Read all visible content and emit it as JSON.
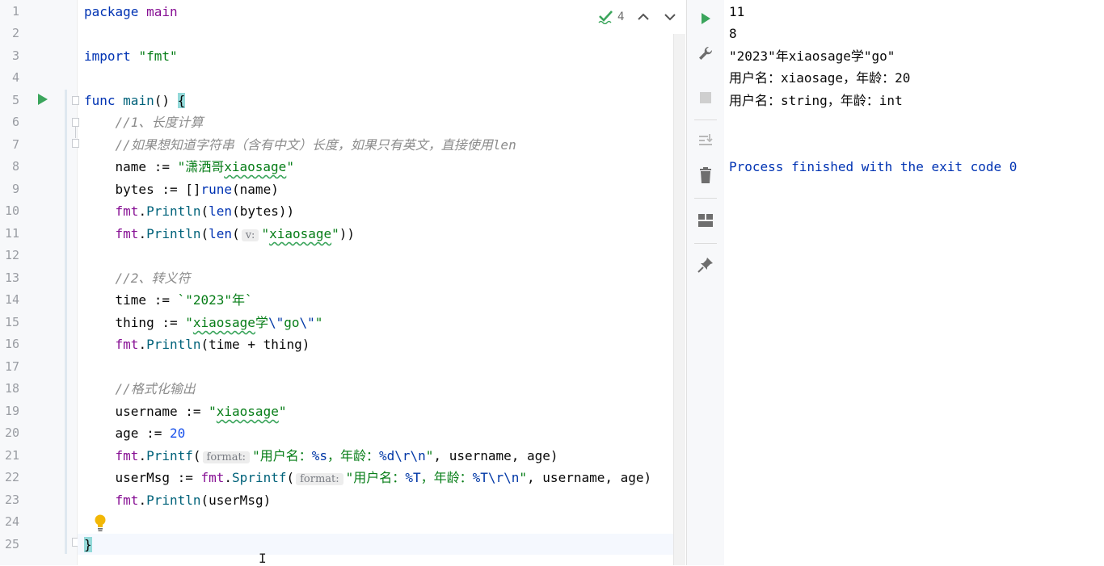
{
  "editor": {
    "line_numbers": [
      "1",
      "2",
      "3",
      "4",
      "5",
      "6",
      "7",
      "8",
      "9",
      "10",
      "11",
      "12",
      "13",
      "14",
      "15",
      "16",
      "17",
      "18",
      "19",
      "20",
      "21",
      "22",
      "23",
      "24",
      "25"
    ],
    "code": {
      "l1_kw": "package",
      "l1_name": "main",
      "l3_kw": "import",
      "l3_str": "\"fmt\"",
      "l5_kw": "func",
      "l5_fn": "main",
      "l5_rest": "() ",
      "l5_brace": "{",
      "l6": "//1、长度计算",
      "l7": "//如果想知道字符串（含有中文）长度，如果只有英文，直接使用len",
      "l8_a": "name := ",
      "l8_q1": "\"",
      "l8_s1": "潇洒哥",
      "l8_s2": "xiaosage",
      "l8_q2": "\"",
      "l9_a": "bytes := []",
      "l9_kw": "rune",
      "l9_b": "(name)",
      "l10_pkg": "fmt",
      "l10_dot": ".",
      "l10_fn": "Println",
      "l10_p": "(",
      "l10_len": "len",
      "l10_rest": "(bytes))",
      "l11_pkg": "fmt",
      "l11_dot": ".",
      "l11_fn": "Println",
      "l11_p": "(",
      "l11_len": "len",
      "l11_p2": "(",
      "l11_hint": "v:",
      "l11_q1": "\"",
      "l11_s": "xiaosage",
      "l11_q2": "\"",
      "l11_rest": "))",
      "l13": "//2、转义符",
      "l14_a": "time := ",
      "l14_s": "`\"2023\"年`",
      "l15_a": "thing := ",
      "l15_q1": "\"",
      "l15_s1": "xiaosage",
      "l15_s2": "学",
      "l15_e1": "\\\"",
      "l15_s3": "go",
      "l15_e2": "\\\"",
      "l15_q2": "\"",
      "l16_pkg": "fmt",
      "l16_dot": ".",
      "l16_fn": "Println",
      "l16_rest": "(time + thing)",
      "l18": "//格式化输出",
      "l19_a": "username := ",
      "l19_q1": "\"",
      "l19_s": "xiaosage",
      "l19_q2": "\"",
      "l20_a": "age := ",
      "l20_n": "20",
      "l21_pkg": "fmt",
      "l21_dot": ".",
      "l21_fn": "Printf",
      "l21_p": "(",
      "l21_hint": "format:",
      "l21_s1": "\"用户名：",
      "l21_v1": "%s",
      "l21_s2": "，年龄：",
      "l21_v2": "%d",
      "l21_e": "\\r\\n",
      "l21_s3": "\"",
      "l21_rest": ", username, age)",
      "l22_a": "userMsg := ",
      "l22_pkg": "fmt",
      "l22_dot": ".",
      "l22_fn": "Sprintf",
      "l22_p": "(",
      "l22_hint": "format:",
      "l22_s1": "\"用户名：",
      "l22_v1": "%T",
      "l22_s2": "，年龄：",
      "l22_v2": "%T",
      "l22_e": "\\r\\n",
      "l22_s3": "\"",
      "l22_rest": ", username, age)",
      "l23_pkg": "fmt",
      "l23_dot": ".",
      "l23_fn": "Println",
      "l23_rest": "(userMsg)",
      "l25": "}"
    },
    "inspection_count": "4"
  },
  "console": {
    "lines": [
      "11",
      "8",
      "\"2023\"年xiaosage学\"go\"",
      "用户名：xiaosage，年龄：20",
      "用户名：string，年龄：int"
    ],
    "finish": "Process finished with the exit code 0"
  },
  "toolbar": {
    "icons": [
      "rerun-icon",
      "wrench-icon",
      "stop-icon",
      "scroll-to-end-icon",
      "trash-icon",
      "layout-icon",
      "pin-icon"
    ]
  },
  "colors": {
    "keyword": "#0033b3",
    "function": "#00627a",
    "string": "#067d17",
    "number": "#1750eb",
    "comment": "#8c8c8c",
    "run_green": "#3ba55c"
  }
}
